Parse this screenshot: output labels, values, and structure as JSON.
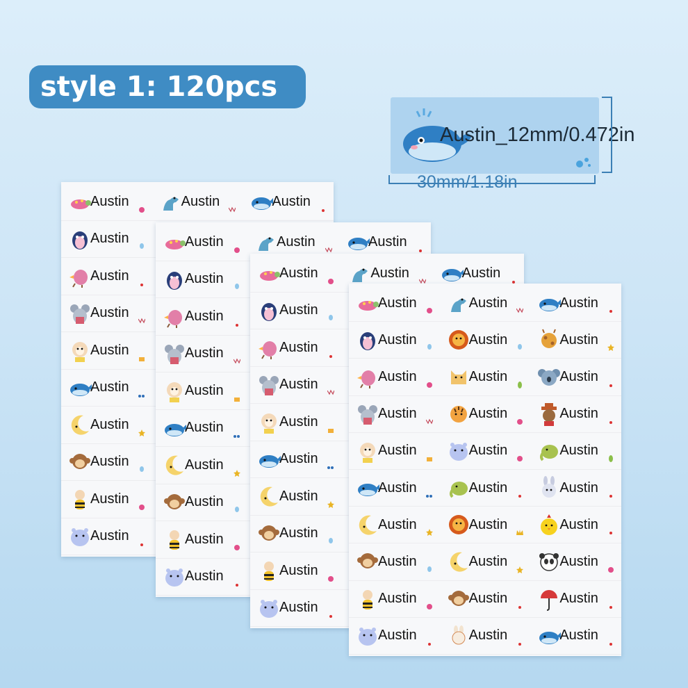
{
  "badge": {
    "text": "style 1: 120pcs"
  },
  "sample": {
    "label_text": "Austin_12mm/0.472in",
    "width_text": "30mm/1.18in",
    "icon": "whale-icon"
  },
  "colors": {
    "badge_bg": "#3f8cc4",
    "sample_bg": "#aed3ef",
    "dimension_text": "#3b7fb5"
  },
  "label_name": "Austin",
  "sheets": [
    {
      "labels": [
        {
          "icon": "turtle-icon",
          "deco": "flower"
        },
        {
          "icon": "dino-icon",
          "deco": "bunting"
        },
        {
          "icon": "whale-icon",
          "deco": "dot"
        },
        {
          "icon": "penguin-icon",
          "deco": "balloon"
        },
        {
          "icon": "turtle-icon",
          "deco": "flower"
        },
        {
          "icon": "dino-icon",
          "deco": "bunting"
        },
        {
          "icon": "bird-icon",
          "deco": "dot"
        },
        {
          "icon": "penguin-icon",
          "deco": "balloon"
        },
        {
          "icon": "turtle-icon",
          "deco": "flower"
        },
        {
          "icon": "mouse-icon",
          "deco": "bunting"
        },
        {
          "icon": "bird-icon",
          "deco": "flower"
        },
        {
          "icon": "penguin-icon",
          "deco": "balloon"
        },
        {
          "icon": "monkey-icon",
          "deco": "cake"
        },
        {
          "icon": "mouse-icon",
          "deco": "bunting"
        },
        {
          "icon": "bird-icon",
          "deco": "flower"
        },
        {
          "icon": "whale-icon",
          "deco": "bubbles"
        },
        {
          "icon": "monkey-icon",
          "deco": "cake"
        },
        {
          "icon": "mouse-icon",
          "deco": "bunting"
        },
        {
          "icon": "moon-icon",
          "deco": "star"
        },
        {
          "icon": "whale-icon",
          "deco": "bubbles"
        },
        {
          "icon": "monkey-icon",
          "deco": "cake"
        },
        {
          "icon": "ape-icon",
          "deco": "balloon"
        },
        {
          "icon": "moon-icon",
          "deco": "star"
        },
        {
          "icon": "whale-icon",
          "deco": "bubbles"
        },
        {
          "icon": "bee-icon",
          "deco": "flower"
        },
        {
          "icon": "ape-icon",
          "deco": "balloon"
        },
        {
          "icon": "moon-icon",
          "deco": "star"
        },
        {
          "icon": "hippo-icon",
          "deco": "dot"
        },
        {
          "icon": "bee-icon",
          "deco": "flower"
        },
        {
          "icon": "ape-icon",
          "deco": "balloon"
        }
      ]
    },
    {
      "labels": [
        {
          "icon": "turtle-icon",
          "deco": "flower"
        },
        {
          "icon": "dino-icon",
          "deco": "bunting"
        },
        {
          "icon": "whale-icon",
          "deco": "dot"
        },
        {
          "icon": "penguin-icon",
          "deco": "balloon"
        },
        {
          "icon": "turtle-icon",
          "deco": "flower"
        },
        {
          "icon": "dino-icon",
          "deco": "bunting"
        },
        {
          "icon": "bird-icon",
          "deco": "dot"
        },
        {
          "icon": "penguin-icon",
          "deco": "balloon"
        },
        {
          "icon": "turtle-icon",
          "deco": "flower"
        },
        {
          "icon": "mouse-icon",
          "deco": "bunting"
        },
        {
          "icon": "bird-icon",
          "deco": "flower"
        },
        {
          "icon": "penguin-icon",
          "deco": "balloon"
        },
        {
          "icon": "monkey-icon",
          "deco": "cake"
        },
        {
          "icon": "mouse-icon",
          "deco": "bunting"
        },
        {
          "icon": "bird-icon",
          "deco": "flower"
        },
        {
          "icon": "whale-icon",
          "deco": "bubbles"
        },
        {
          "icon": "monkey-icon",
          "deco": "cake"
        },
        {
          "icon": "mouse-icon",
          "deco": "bunting"
        },
        {
          "icon": "moon-icon",
          "deco": "star"
        },
        {
          "icon": "whale-icon",
          "deco": "bubbles"
        },
        {
          "icon": "monkey-icon",
          "deco": "cake"
        },
        {
          "icon": "ape-icon",
          "deco": "balloon"
        },
        {
          "icon": "moon-icon",
          "deco": "star"
        },
        {
          "icon": "whale-icon",
          "deco": "bubbles"
        },
        {
          "icon": "bee-icon",
          "deco": "flower"
        },
        {
          "icon": "ape-icon",
          "deco": "balloon"
        },
        {
          "icon": "moon-icon",
          "deco": "star"
        },
        {
          "icon": "hippo-icon",
          "deco": "dot"
        },
        {
          "icon": "bee-icon",
          "deco": "flower"
        },
        {
          "icon": "ape-icon",
          "deco": "balloon"
        }
      ]
    },
    {
      "labels": [
        {
          "icon": "turtle-icon",
          "deco": "flower"
        },
        {
          "icon": "dino-icon",
          "deco": "bunting"
        },
        {
          "icon": "whale-icon",
          "deco": "dot"
        },
        {
          "icon": "penguin-icon",
          "deco": "balloon"
        },
        {
          "icon": "turtle-icon",
          "deco": "flower"
        },
        {
          "icon": "dino-icon",
          "deco": "bunting"
        },
        {
          "icon": "bird-icon",
          "deco": "dot"
        },
        {
          "icon": "penguin-icon",
          "deco": "balloon"
        },
        {
          "icon": "turtle-icon",
          "deco": "flower"
        },
        {
          "icon": "mouse-icon",
          "deco": "bunting"
        },
        {
          "icon": "bird-icon",
          "deco": "flower"
        },
        {
          "icon": "penguin-icon",
          "deco": "balloon"
        },
        {
          "icon": "monkey-icon",
          "deco": "cake"
        },
        {
          "icon": "mouse-icon",
          "deco": "bunting"
        },
        {
          "icon": "bird-icon",
          "deco": "flower"
        },
        {
          "icon": "whale-icon",
          "deco": "bubbles"
        },
        {
          "icon": "monkey-icon",
          "deco": "cake"
        },
        {
          "icon": "mouse-icon",
          "deco": "bunting"
        },
        {
          "icon": "moon-icon",
          "deco": "star"
        },
        {
          "icon": "whale-icon",
          "deco": "bubbles"
        },
        {
          "icon": "monkey-icon",
          "deco": "cake"
        },
        {
          "icon": "ape-icon",
          "deco": "balloon"
        },
        {
          "icon": "moon-icon",
          "deco": "star"
        },
        {
          "icon": "whale-icon",
          "deco": "bubbles"
        },
        {
          "icon": "bee-icon",
          "deco": "flower"
        },
        {
          "icon": "ape-icon",
          "deco": "balloon"
        },
        {
          "icon": "moon-icon",
          "deco": "star"
        },
        {
          "icon": "hippo-icon",
          "deco": "dot"
        },
        {
          "icon": "bee-icon",
          "deco": "flower"
        },
        {
          "icon": "ape-icon",
          "deco": "balloon"
        }
      ]
    },
    {
      "labels": [
        {
          "icon": "turtle-icon",
          "deco": "flower"
        },
        {
          "icon": "dino-icon",
          "deco": "bunting"
        },
        {
          "icon": "whale-icon",
          "deco": "dot"
        },
        {
          "icon": "penguin-icon",
          "deco": "balloon"
        },
        {
          "icon": "lion-icon",
          "deco": "balloon"
        },
        {
          "icon": "giraffe-icon",
          "deco": "star"
        },
        {
          "icon": "bird-icon",
          "deco": "flower"
        },
        {
          "icon": "cat-icon",
          "deco": "leaf"
        },
        {
          "icon": "koala-icon",
          "deco": "dot"
        },
        {
          "icon": "mouse-icon",
          "deco": "bunting"
        },
        {
          "icon": "tiger-icon",
          "deco": "flower"
        },
        {
          "icon": "cowboy-icon",
          "deco": "dot"
        },
        {
          "icon": "monkey-icon",
          "deco": "cake"
        },
        {
          "icon": "hippo-icon",
          "deco": "flower"
        },
        {
          "icon": "elephant-icon",
          "deco": "leaf"
        },
        {
          "icon": "whale-icon",
          "deco": "bubbles"
        },
        {
          "icon": "elephant-icon",
          "deco": "dot"
        },
        {
          "icon": "bunny-icon",
          "deco": "dot"
        },
        {
          "icon": "moon-icon",
          "deco": "star"
        },
        {
          "icon": "lion-icon",
          "deco": "crown"
        },
        {
          "icon": "chick-icon",
          "deco": "dot"
        },
        {
          "icon": "ape-icon",
          "deco": "balloon"
        },
        {
          "icon": "moon-icon",
          "deco": "star"
        },
        {
          "icon": "panda-icon",
          "deco": "flower"
        },
        {
          "icon": "bee-icon",
          "deco": "flower"
        },
        {
          "icon": "ape-icon",
          "deco": "dot"
        },
        {
          "icon": "umbrella-icon",
          "deco": "dot"
        },
        {
          "icon": "hippo-icon",
          "deco": "dot"
        },
        {
          "icon": "rabbit-icon",
          "deco": "dot"
        },
        {
          "icon": "whale-icon",
          "deco": "dot"
        }
      ]
    }
  ]
}
